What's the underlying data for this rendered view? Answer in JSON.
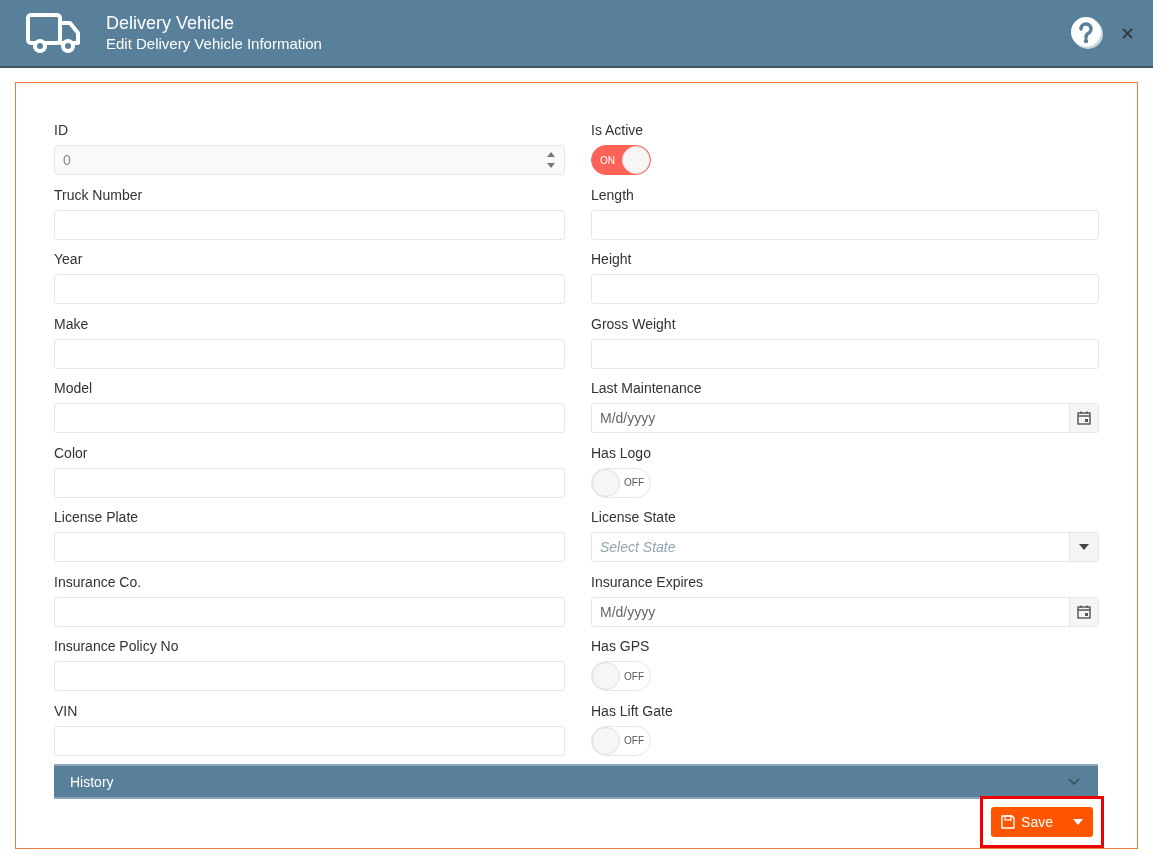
{
  "header": {
    "title": "Delivery Vehicle",
    "subtitle": "Edit Delivery Vehicle Information"
  },
  "columns": [
    [
      {
        "label": "ID",
        "kind": "numeric",
        "value": "0"
      },
      {
        "label": "Truck Number",
        "kind": "text"
      },
      {
        "label": "Year",
        "kind": "text"
      },
      {
        "label": "Make",
        "kind": "text"
      },
      {
        "label": "Model",
        "kind": "text"
      },
      {
        "label": "Color",
        "kind": "text"
      },
      {
        "label": "License Plate",
        "kind": "text"
      },
      {
        "label": "Insurance Co.",
        "kind": "text"
      },
      {
        "label": "Insurance Policy No",
        "kind": "text"
      },
      {
        "label": "VIN",
        "kind": "text"
      }
    ],
    [
      {
        "label": "Is Active",
        "kind": "switch",
        "on": true,
        "state_text": "ON"
      },
      {
        "label": "Length",
        "kind": "text"
      },
      {
        "label": "Height",
        "kind": "text"
      },
      {
        "label": "Gross Weight",
        "kind": "text"
      },
      {
        "label": "Last Maintenance",
        "kind": "date",
        "placeholder": "M/d/yyyy"
      },
      {
        "label": "Has Logo",
        "kind": "switch",
        "on": false,
        "state_text": "OFF"
      },
      {
        "label": "License State",
        "kind": "select",
        "placeholder": "Select State"
      },
      {
        "label": "Insurance Expires",
        "kind": "date",
        "placeholder": "M/d/yyyy"
      },
      {
        "label": "Has GPS",
        "kind": "switch",
        "on": false,
        "state_text": "OFF"
      },
      {
        "label": "Has Lift Gate",
        "kind": "switch",
        "on": false,
        "state_text": "OFF"
      }
    ]
  ],
  "history": {
    "label": "History",
    "expanded": false
  },
  "save_button": {
    "label": "Save",
    "highlighted": true
  }
}
